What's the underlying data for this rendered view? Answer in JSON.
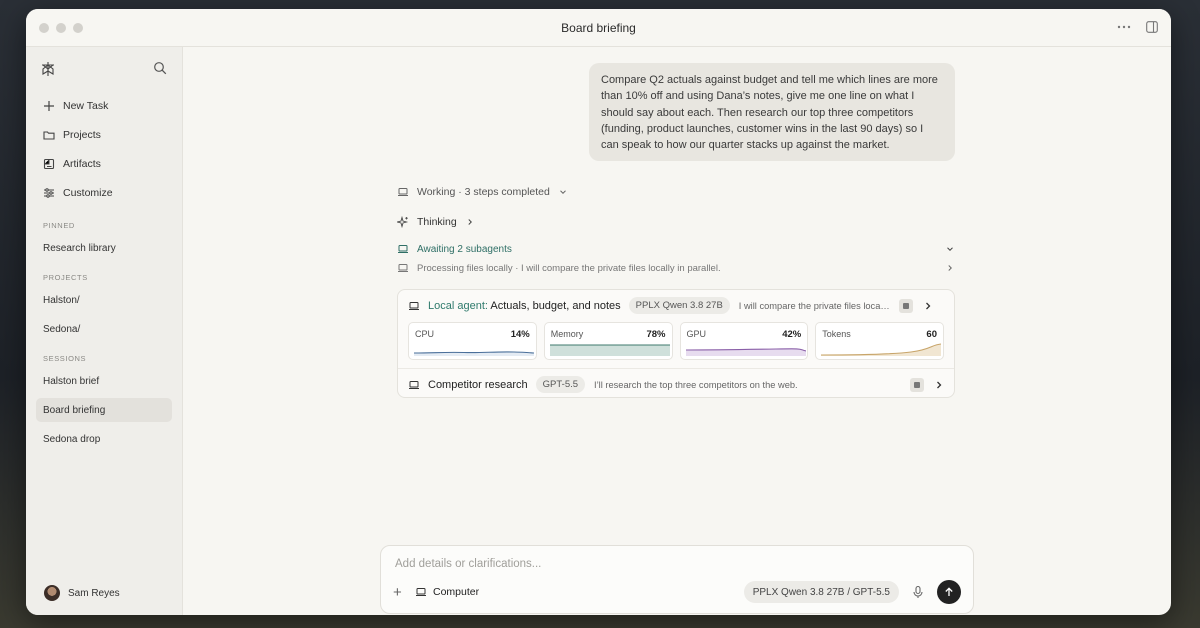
{
  "window": {
    "title": "Board briefing"
  },
  "sidebar": {
    "nav": [
      {
        "label": "New Task",
        "icon": "plus-icon"
      },
      {
        "label": "Projects",
        "icon": "folder-icon"
      },
      {
        "label": "Artifacts",
        "icon": "artifact-icon"
      },
      {
        "label": "Customize",
        "icon": "sliders-icon"
      }
    ],
    "pinned_label": "PINNED",
    "pinned": [
      "Research library"
    ],
    "projects_label": "PROJECTS",
    "projects": [
      "Halston/",
      "Sedona/"
    ],
    "sessions_label": "SESSIONS",
    "sessions": [
      "Halston brief",
      "Board briefing",
      "Sedona drop"
    ],
    "active_session": "Board briefing",
    "user": "Sam Reyes"
  },
  "chat": {
    "user_message": "Compare Q2 actuals against budget and tell me which lines are more than 10% off and using Dana’s notes, give me one line on what I should say about each. Then research our top three competitors (funding, product launches, customer wins in the last 90 days) so I can speak to how our quarter stacks up against the market.",
    "working": "Working · 3 steps completed",
    "thinking": "Thinking",
    "awaiting": "Awaiting 2 subagents",
    "processing": "Processing files locally · I will compare the private files locally in parallel."
  },
  "agents": {
    "local": {
      "prefix": "Local agent:",
      "title": "Actuals, budget, and notes",
      "model": "PPLX Qwen 3.8 27B",
      "desc": "I will compare the private files locally in parallel."
    },
    "metrics": [
      {
        "label": "CPU",
        "value": "14%",
        "color": "#4a6f9a",
        "fill": "#dce6f0"
      },
      {
        "label": "Memory",
        "value": "78%",
        "color": "#3f7a6e",
        "fill": "#cfe0db"
      },
      {
        "label": "GPU",
        "value": "42%",
        "color": "#8a5fa8",
        "fill": "#e7dcef"
      },
      {
        "label": "Tokens",
        "value": "60",
        "color": "#c8a56a",
        "fill": "#f1e6d2"
      }
    ],
    "competitor": {
      "title": "Competitor research",
      "model": "GPT-5.5",
      "desc": "I’ll research the top three competitors on the web."
    }
  },
  "composer": {
    "placeholder": "Add details or clarifications...",
    "mode": "Computer",
    "model": "PPLX Qwen 3.8 27B / GPT-5.5"
  }
}
